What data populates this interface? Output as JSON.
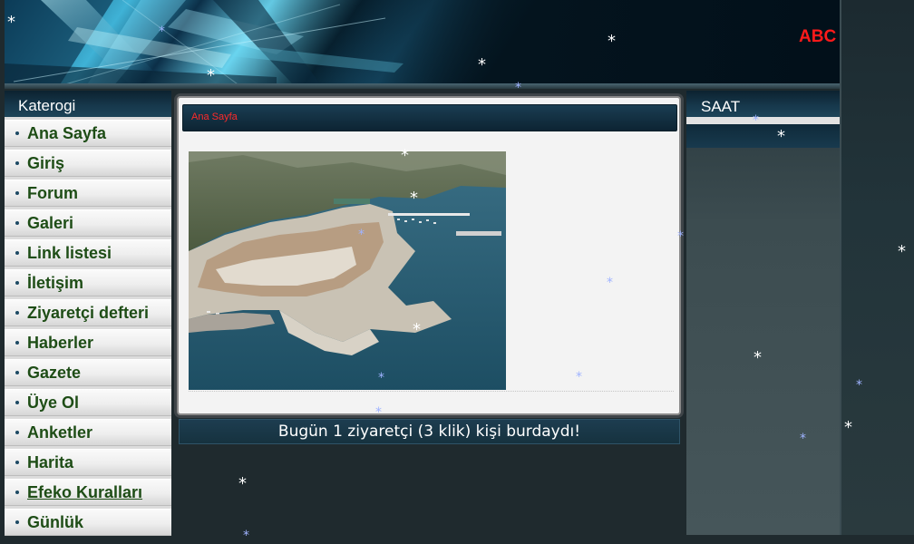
{
  "header": {
    "brand": "ABC"
  },
  "sidebar": {
    "title": "Katerogi",
    "items": [
      {
        "label": "Ana Sayfa",
        "name": "ana-sayfa"
      },
      {
        "label": "Giriş",
        "name": "giris"
      },
      {
        "label": "Forum",
        "name": "forum"
      },
      {
        "label": "Galeri",
        "name": "galeri"
      },
      {
        "label": "Link listesi",
        "name": "link-listesi"
      },
      {
        "label": "İletişim",
        "name": "iletisim"
      },
      {
        "label": "Ziyaretçi defteri",
        "name": "ziyaretci-defteri"
      },
      {
        "label": "Haberler",
        "name": "haberler"
      },
      {
        "label": "Gazete",
        "name": "gazete"
      },
      {
        "label": "Üye Ol",
        "name": "uye-ol"
      },
      {
        "label": "Anketler",
        "name": "anketler"
      },
      {
        "label": "Harita",
        "name": "harita"
      },
      {
        "label": "Efeko Kuralları",
        "name": "efeko-kurallari",
        "active": true
      },
      {
        "label": "Günlük",
        "name": "gunluk"
      }
    ]
  },
  "main": {
    "tab_label": "Ana Sayfa",
    "visitor_text": "Bugün 1 ziyaretçi (3 klik) kişi burdaydı!"
  },
  "right_panel": {
    "title": "SAAT"
  },
  "decorations": {
    "snowflake_glyph": "*"
  },
  "colors": {
    "brand": "#ff1a1a",
    "tab_label": "#ff2a2a",
    "menu_text": "#1e4d16"
  }
}
